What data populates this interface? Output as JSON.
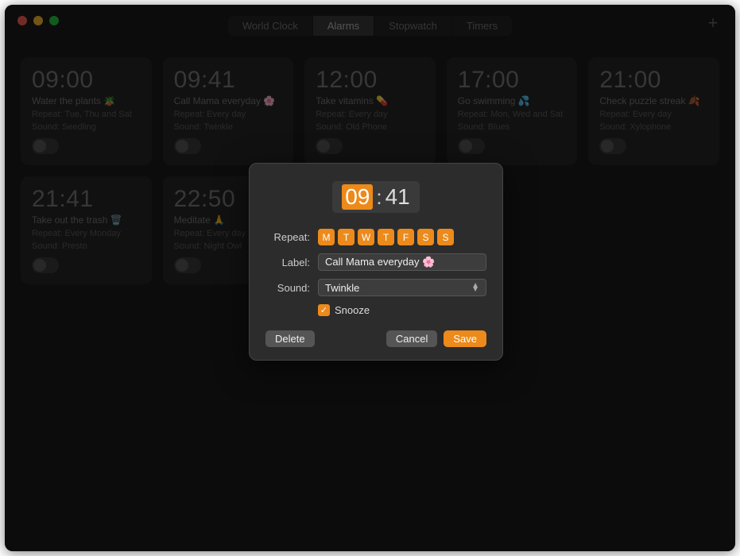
{
  "titlebar": {
    "tabs": [
      {
        "label": "World Clock",
        "active": false
      },
      {
        "label": "Alarms",
        "active": true
      },
      {
        "label": "Stopwatch",
        "active": false
      },
      {
        "label": "Timers",
        "active": false
      }
    ],
    "add_label": "+"
  },
  "alarms": [
    {
      "time": "09:00",
      "label": "Water the plants 🪴",
      "repeat": "Repeat: Tue, Thu and Sat",
      "sound": "Sound: Seedling"
    },
    {
      "time": "09:41",
      "label": "Call Mama everyday 🌸",
      "repeat": "Repeat: Every day",
      "sound": "Sound: Twinkle"
    },
    {
      "time": "12:00",
      "label": "Take vitamins 💊",
      "repeat": "Repeat: Every day",
      "sound": "Sound: Old Phone"
    },
    {
      "time": "17:00",
      "label": "Go swimming 💦",
      "repeat": "Repeat: Mon, Wed and Sat",
      "sound": "Sound: Blues"
    },
    {
      "time": "21:00",
      "label": "Check puzzle streak 🍂",
      "repeat": "Repeat: Every day",
      "sound": "Sound: Xylophone"
    },
    {
      "time": "21:41",
      "label": "Take out the trash 🗑️",
      "repeat": "Repeat: Every Monday",
      "sound": "Sound: Presto"
    },
    {
      "time": "22:50",
      "label": "Meditate 🙏",
      "repeat": "Repeat: Every day",
      "sound": "Sound: Night Owl"
    }
  ],
  "dialog": {
    "hours": "09",
    "minutes": "41",
    "repeat_label": "Repeat:",
    "days": [
      "M",
      "T",
      "W",
      "T",
      "F",
      "S",
      "S"
    ],
    "label_label": "Label:",
    "label_value": "Call Mama everyday 🌸",
    "sound_label": "Sound:",
    "sound_value": "Twinkle",
    "snooze_label": "Snooze",
    "delete_label": "Delete",
    "cancel_label": "Cancel",
    "save_label": "Save"
  }
}
